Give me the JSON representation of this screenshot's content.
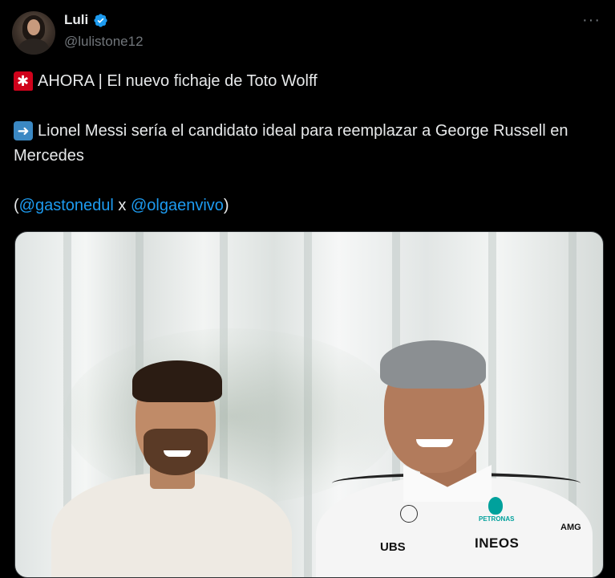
{
  "author": {
    "display_name": "Luli",
    "handle": "@lulistone12",
    "verified": true,
    "avatar_icon": "profile-photo"
  },
  "menu": {
    "more_label": "···"
  },
  "tweet": {
    "line1": "AHORA | El nuevo fichaje de Toto Wolff",
    "line2": "Lionel Messi sería el candidato ideal para reemplazar a George Russell en Mercedes",
    "credit_open": "(",
    "mention1": "@gastonedul",
    "credit_sep": " x ",
    "mention2": "@olgaenvivo",
    "credit_close": ")",
    "emoji1": "rotating-light-icon",
    "emoji2": "right-arrow-icon"
  },
  "media": {
    "sponsors": {
      "petronas": "PETRONAS",
      "ineos": "INEOS",
      "ubs": "UBS",
      "amg": "AMG"
    }
  },
  "colors": {
    "background": "#000000",
    "text": "#e7e9ea",
    "secondary": "#71767b",
    "link": "#1d9bf0",
    "verified": "#1d9bf0"
  }
}
